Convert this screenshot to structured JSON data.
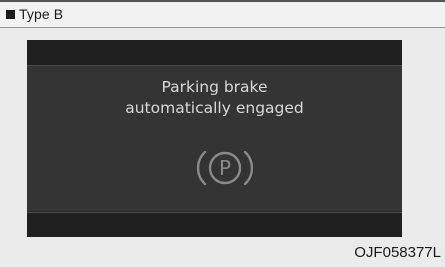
{
  "header": {
    "label": "Type B"
  },
  "display": {
    "message_line1": "Parking brake",
    "message_line2": "automatically engaged",
    "icon": "parking-brake-icon",
    "icon_letter": "P"
  },
  "figure_code": "OJF058377L",
  "colors": {
    "screen_bg": "#2a2a2a",
    "panel_bg": "#343434",
    "text": "#d8d8d8",
    "icon": "#8a8a8a"
  }
}
